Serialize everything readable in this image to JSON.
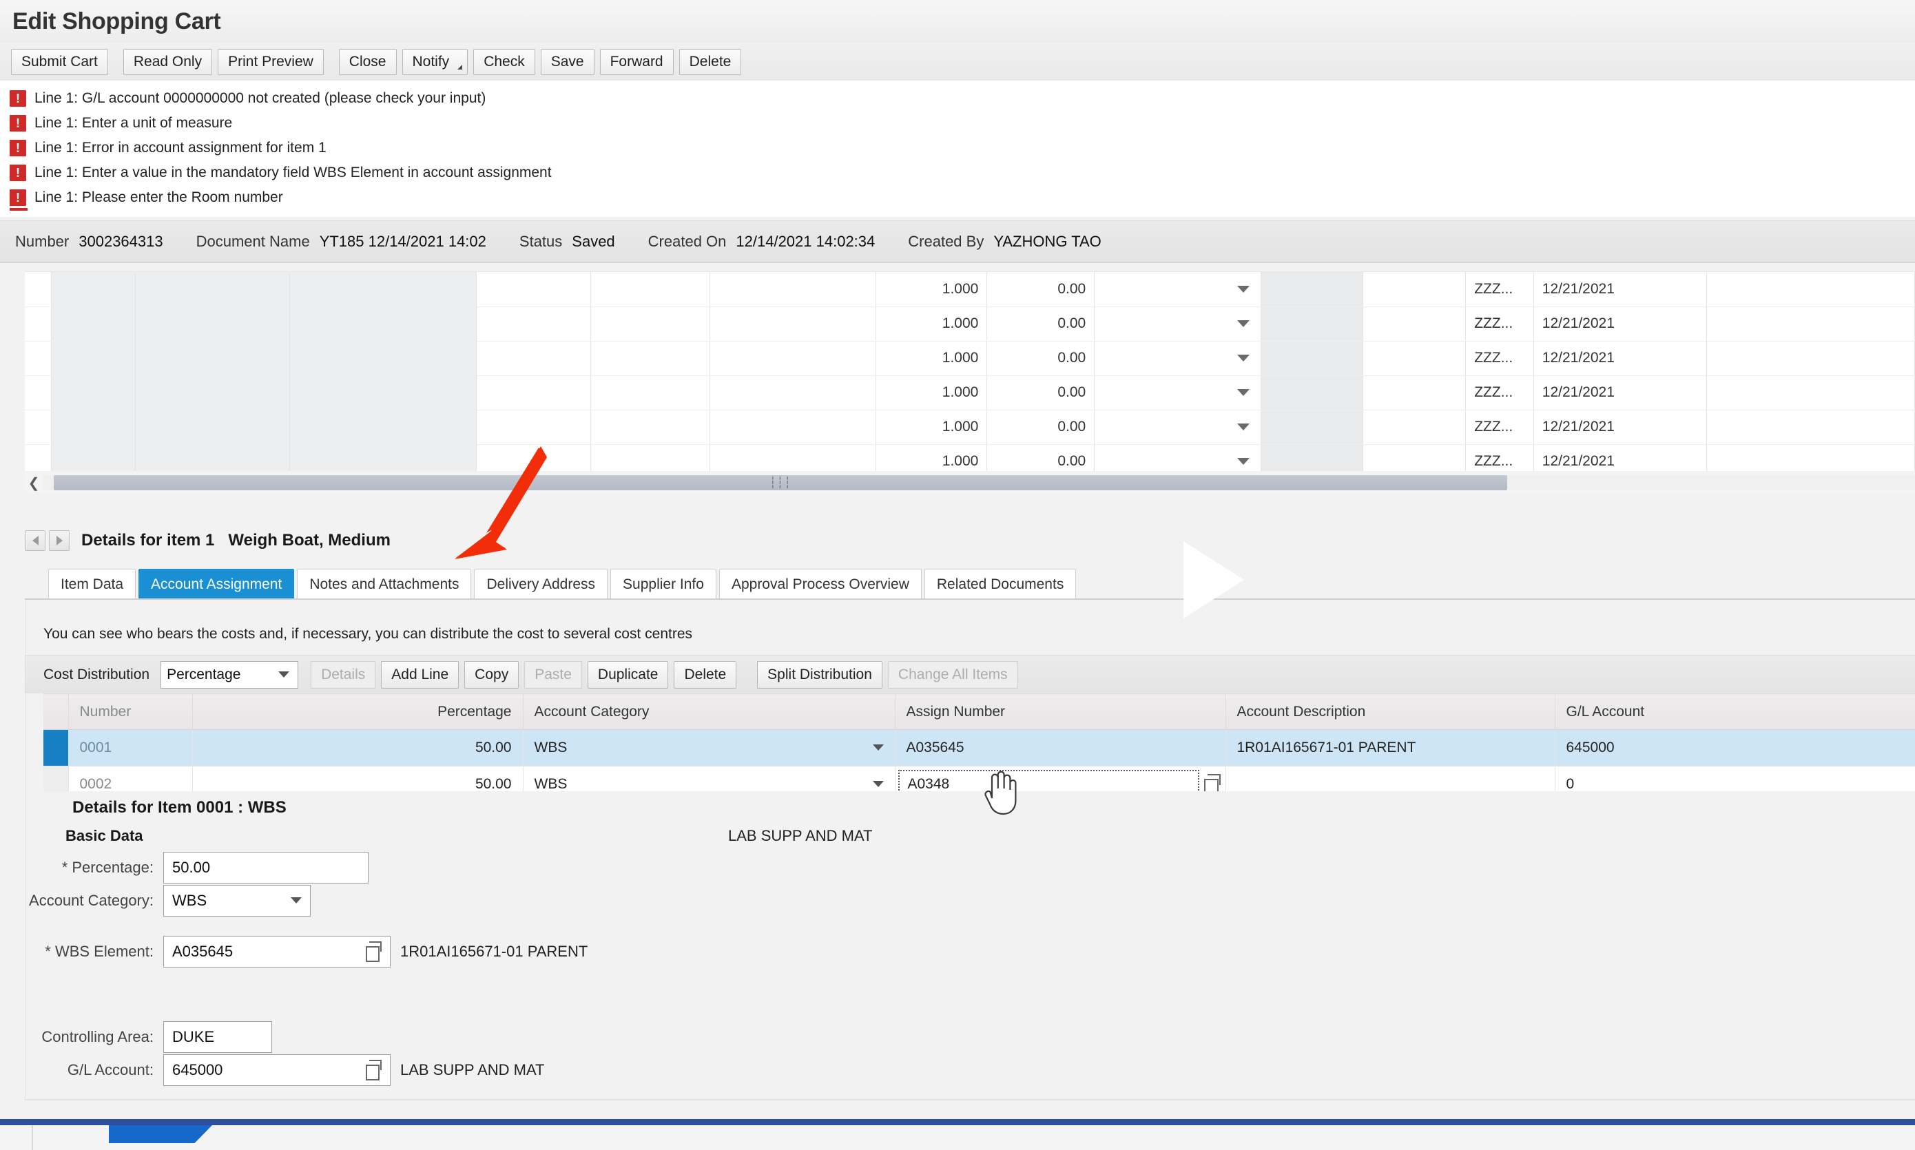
{
  "window": {
    "title": "Edit Shopping Cart"
  },
  "toolbar": {
    "buttons": [
      {
        "label": "Submit Cart",
        "split": false
      },
      {
        "label": "Read Only",
        "split": false
      },
      {
        "label": "Print Preview",
        "split": false
      },
      {
        "label": "Close",
        "split": false
      },
      {
        "label": "Notify",
        "split": true
      },
      {
        "label": "Check",
        "split": false
      },
      {
        "label": "Save",
        "split": false
      },
      {
        "label": "Forward",
        "split": false
      },
      {
        "label": "Delete",
        "split": false
      }
    ]
  },
  "messages": [
    {
      "type": "error",
      "text": "Line 1: G/L account 0000000000 not created (please check your input)"
    },
    {
      "type": "error",
      "text": "Line 1: Enter a unit of measure"
    },
    {
      "type": "error",
      "text": "Line 1: Error in account assignment for item 1"
    },
    {
      "type": "error",
      "text": "Line 1: Enter a value in the mandatory field WBS Element in account assignment"
    },
    {
      "type": "error",
      "text": "Line 1: Please enter the Room number"
    }
  ],
  "document": {
    "fields": [
      {
        "label": "Number",
        "value": "3002364313"
      },
      {
        "label": "Document Name",
        "value": "YT185 12/14/2021 14:02"
      },
      {
        "label": "Status",
        "value": "Saved"
      },
      {
        "label": "Created On",
        "value": "12/14/2021 14:02:34"
      },
      {
        "label": "Created By",
        "value": "YAZHONG TAO"
      }
    ]
  },
  "item_table": {
    "rows": [
      {
        "quantity": "1.000",
        "price": "0.00",
        "code": "ZZZ...",
        "date": "12/21/2021"
      },
      {
        "quantity": "1.000",
        "price": "0.00",
        "code": "ZZZ...",
        "date": "12/21/2021"
      },
      {
        "quantity": "1.000",
        "price": "0.00",
        "code": "ZZZ...",
        "date": "12/21/2021"
      },
      {
        "quantity": "1.000",
        "price": "0.00",
        "code": "ZZZ...",
        "date": "12/21/2021"
      },
      {
        "quantity": "1.000",
        "price": "0.00",
        "code": "ZZZ...",
        "date": "12/21/2021"
      },
      {
        "quantity": "1.000",
        "price": "0.00",
        "code": "ZZZ...",
        "date": "12/21/2021"
      }
    ]
  },
  "details": {
    "header_label": "Details for item 1",
    "header_item": "Weigh Boat, Medium",
    "tabs": [
      {
        "label": "Item Data",
        "active": false
      },
      {
        "label": "Account Assignment",
        "active": true
      },
      {
        "label": "Notes and Attachments",
        "active": false
      },
      {
        "label": "Delivery Address",
        "active": false
      },
      {
        "label": "Supplier Info",
        "active": false
      },
      {
        "label": "Approval Process Overview",
        "active": false
      },
      {
        "label": "Related Documents",
        "active": false
      }
    ]
  },
  "account_assignment": {
    "hint": "You can see who bears the costs and, if necessary, you can distribute the cost to several cost centres",
    "cost_distribution_label": "Cost Distribution",
    "cost_distribution_value": "Percentage",
    "buttons": [
      {
        "label": "Details",
        "disabled": true,
        "group": 1
      },
      {
        "label": "Add Line",
        "disabled": false,
        "group": 1
      },
      {
        "label": "Copy",
        "disabled": false,
        "group": 1
      },
      {
        "label": "Paste",
        "disabled": true,
        "group": 1
      },
      {
        "label": "Duplicate",
        "disabled": false,
        "group": 1
      },
      {
        "label": "Delete",
        "disabled": false,
        "group": 1
      },
      {
        "label": "Split Distribution",
        "disabled": false,
        "group": 2
      },
      {
        "label": "Change All Items",
        "disabled": true,
        "group": 2
      }
    ],
    "columns": [
      "Number",
      "Percentage",
      "Account Category",
      "Assign Number",
      "Account Description",
      "G/L Account"
    ],
    "rows": [
      {
        "number": "0001",
        "percentage": "50.00",
        "account_category": "WBS",
        "assign_number": "A035645",
        "account_description": "1R01AI165671-01 PARENT",
        "gl_account": "645000",
        "selected": true,
        "editing": false
      },
      {
        "number": "0002",
        "percentage": "50.00",
        "account_category": "WBS",
        "assign_number": "A0348",
        "account_description": "",
        "gl_account": "0",
        "selected": false,
        "editing": true
      }
    ]
  },
  "item_detail": {
    "title": "Details for Item 0001 : WBS",
    "section": "Basic Data",
    "side_note": "LAB SUPP AND MAT",
    "fields": {
      "percentage_label": "* Percentage:",
      "percentage_value": "50.00",
      "account_category_label": "Account Category:",
      "account_category_value": "WBS",
      "wbs_element_label": "* WBS Element:",
      "wbs_element_value": "A035645",
      "wbs_element_desc": "1R01AI165671-01 PARENT",
      "controlling_area_label": "Controlling Area:",
      "controlling_area_value": "DUKE",
      "gl_account_label": "G/L Account:",
      "gl_account_value": "645000",
      "gl_account_desc": "LAB SUPP AND MAT"
    }
  },
  "colors": {
    "accent_blue": "#1a8fd4",
    "selected_row": "#cde5f5",
    "error_red": "#cf2a27",
    "annotation_red": "#f22d0a",
    "taskbar_blue": "#2f4c9e"
  }
}
